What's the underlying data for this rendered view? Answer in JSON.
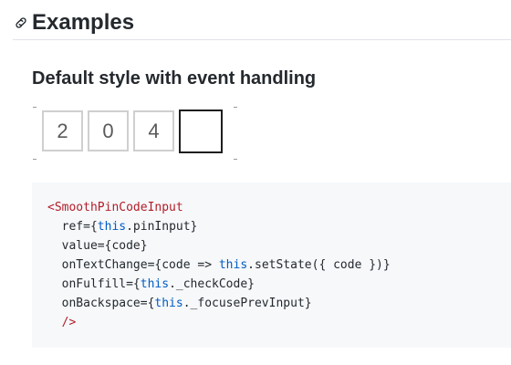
{
  "heading": {
    "title": "Examples",
    "anchor_icon": "link-icon"
  },
  "subheading": {
    "title": "Default style with event handling"
  },
  "pin_input": {
    "digits": [
      "2",
      "0",
      "4",
      ""
    ],
    "active_index": 3
  },
  "code": {
    "lines": [
      [
        {
          "t": "<SmoothPinCodeInput",
          "c": "tag"
        }
      ],
      [
        {
          "t": "  ref=",
          "c": "attr"
        },
        {
          "t": "{",
          "c": "punct"
        },
        {
          "t": "this",
          "c": "kw"
        },
        {
          "t": ".pinInput}",
          "c": "punct"
        }
      ],
      [
        {
          "t": "  value=",
          "c": "attr"
        },
        {
          "t": "{code}",
          "c": "punct"
        }
      ],
      [
        {
          "t": "  onTextChange=",
          "c": "attr"
        },
        {
          "t": "{code => ",
          "c": "punct"
        },
        {
          "t": "this",
          "c": "kw"
        },
        {
          "t": ".setState({ code })}",
          "c": "punct"
        }
      ],
      [
        {
          "t": "  onFulfill=",
          "c": "attr"
        },
        {
          "t": "{",
          "c": "punct"
        },
        {
          "t": "this",
          "c": "kw"
        },
        {
          "t": "._checkCode}",
          "c": "punct"
        }
      ],
      [
        {
          "t": "  onBackspace=",
          "c": "attr"
        },
        {
          "t": "{",
          "c": "punct"
        },
        {
          "t": "this",
          "c": "kw"
        },
        {
          "t": "._focusePrevInput}",
          "c": "punct"
        }
      ],
      [
        {
          "t": "  />",
          "c": "tag"
        }
      ]
    ]
  },
  "colors": {
    "text": "#24292e",
    "tag": "#b31d28",
    "keyword": "#005cc5",
    "code_bg": "#f6f8fa",
    "cell_border": "#cfcfcf",
    "cell_active_border": "#1e1e1e"
  }
}
